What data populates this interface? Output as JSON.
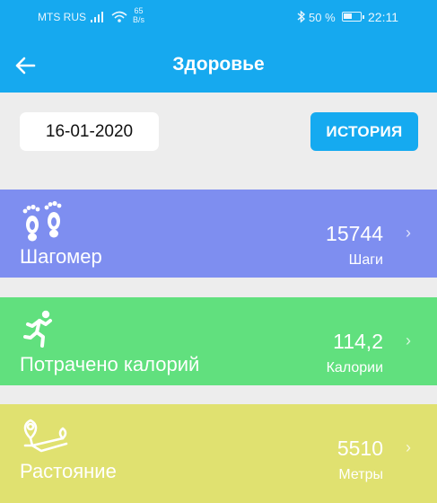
{
  "status": {
    "carrier": "MTS RUS",
    "speed_value": "65",
    "speed_unit": "B/s",
    "battery_pct": "50 %",
    "battery_level": 0.5,
    "time": "22:11"
  },
  "header": {
    "title": "Здоровье",
    "back_icon": "arrow-left-icon",
    "color": "#16a9ef"
  },
  "controls": {
    "date": "16-01-2020",
    "history_label": "ИСТОРИЯ"
  },
  "cards": [
    {
      "label": "Шагомер",
      "value": "15744",
      "unit": "Шаги",
      "icon": "footprints-icon",
      "color": "#7e8ef0"
    },
    {
      "label": "Потрачено калорий",
      "value": "114,2",
      "unit": "Калории",
      "icon": "running-person-icon",
      "color": "#61e07e"
    },
    {
      "label": "Растояние",
      "value": "5510",
      "unit": "Метры",
      "icon": "route-pin-icon",
      "color": "#e0e170"
    }
  ]
}
